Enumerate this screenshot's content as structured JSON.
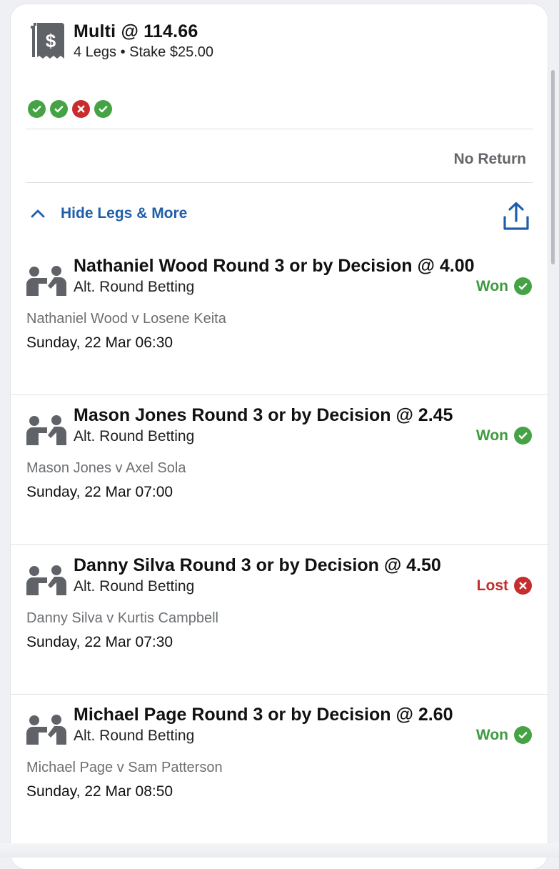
{
  "bet": {
    "title": "Multi @ 114.66",
    "subtitle": "4 Legs • Stake $25.00",
    "icon": "receipt-dollar-icon"
  },
  "leg_statuses": [
    "won",
    "won",
    "lost",
    "won"
  ],
  "return_text": "No Return",
  "toggle": {
    "label": "Hide Legs & More",
    "icon": "chevron-up-icon"
  },
  "share": {
    "icon": "share-icon"
  },
  "colors": {
    "won": "#45a345",
    "lost": "#c72d2d",
    "link": "#1f5ea8"
  },
  "legs": [
    {
      "title": "Nathaniel Wood Round 3 or by Decision @ 4.00",
      "market": "Alt. Round Betting",
      "result": "Won",
      "event": "Nathaniel Wood v Losene Keita",
      "time": "Sunday, 22 Mar 06:30"
    },
    {
      "title": "Mason Jones Round 3 or by Decision @ 2.45",
      "market": "Alt. Round Betting",
      "result": "Won",
      "event": "Mason Jones v Axel Sola",
      "time": "Sunday, 22 Mar 07:00"
    },
    {
      "title": "Danny Silva Round 3 or by Decision @ 4.50",
      "market": "Alt. Round Betting",
      "result": "Lost",
      "event": "Danny Silva v Kurtis Campbell",
      "time": "Sunday, 22 Mar 07:30"
    },
    {
      "title": "Michael Page Round 3 or by Decision @ 2.60",
      "market": "Alt. Round Betting",
      "result": "Won",
      "event": "Michael Page v Sam Patterson",
      "time": "Sunday, 22 Mar 08:50"
    }
  ]
}
